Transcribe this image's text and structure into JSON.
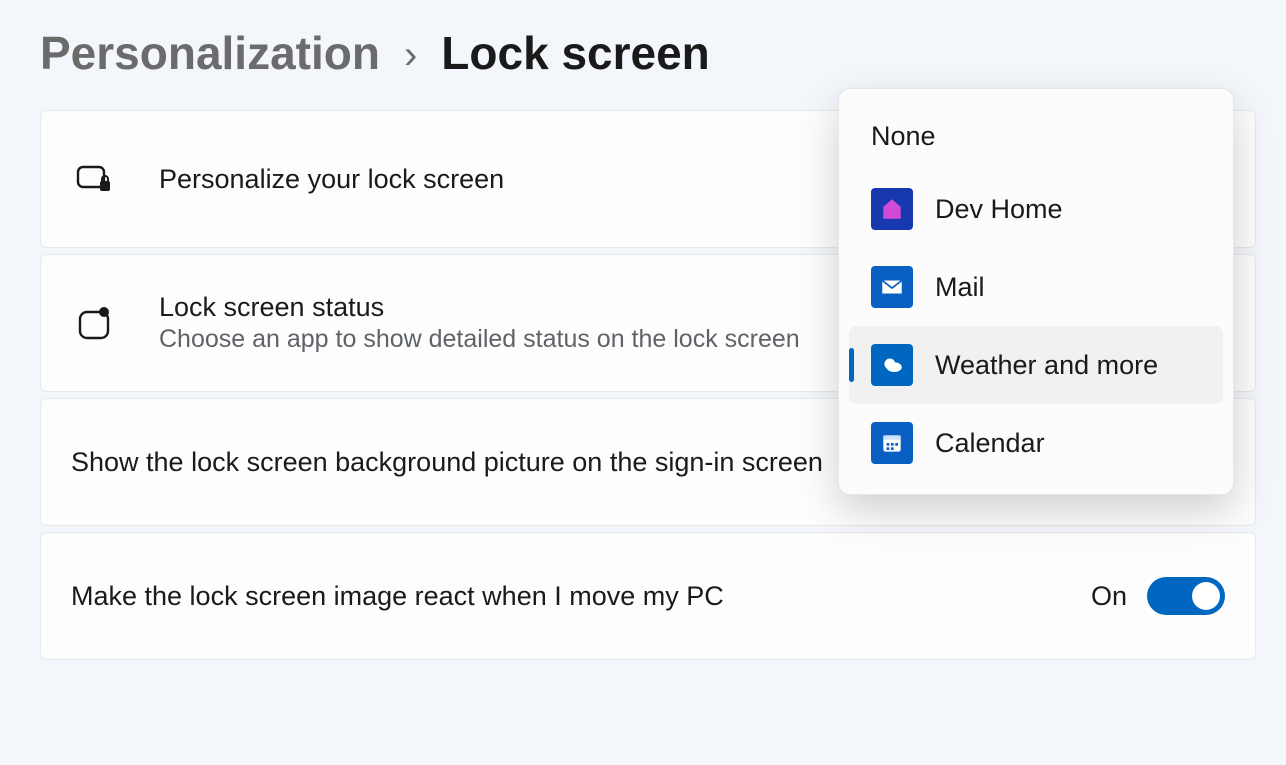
{
  "breadcrumb": {
    "parent": "Personalization",
    "current": "Lock screen"
  },
  "rows": {
    "personalize": {
      "title": "Personalize your lock screen"
    },
    "status": {
      "title": "Lock screen status",
      "desc": "Choose an app to show detailed status on the lock screen"
    },
    "signinbg": {
      "title": "Show the lock screen background picture on the sign-in screen",
      "toggle_state": "On"
    },
    "react": {
      "title": "Make the lock screen image react when I move my PC",
      "toggle_state": "On"
    }
  },
  "dropdown": {
    "none": "None",
    "items": [
      {
        "label": "Dev Home",
        "icon": "devhome-icon",
        "selected": false
      },
      {
        "label": "Mail",
        "icon": "mail-icon",
        "selected": false
      },
      {
        "label": "Weather and more",
        "icon": "weather-icon",
        "selected": true
      },
      {
        "label": "Calendar",
        "icon": "calendar-icon",
        "selected": false
      }
    ]
  }
}
